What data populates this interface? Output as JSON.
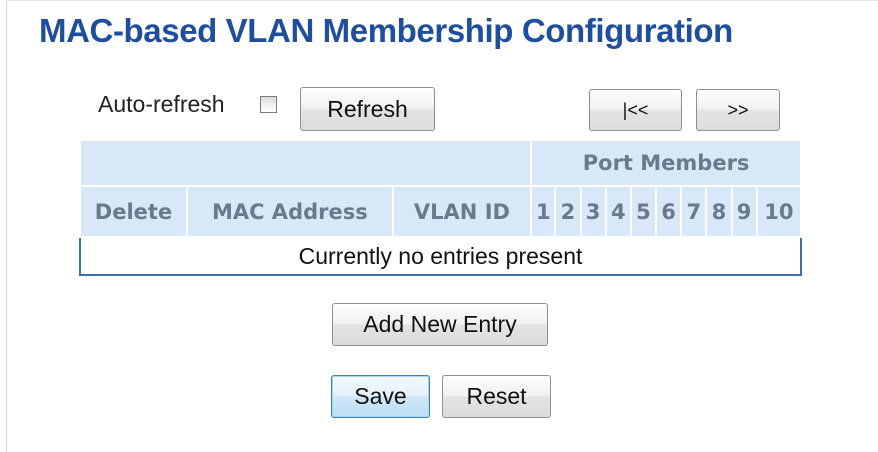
{
  "page": {
    "title": "MAC-based VLAN Membership Configuration"
  },
  "toolbar": {
    "auto_refresh_label": "Auto-refresh",
    "auto_refresh_checked": false,
    "refresh_label": "Refresh",
    "first_page_label": "|<<",
    "next_page_label": ">>"
  },
  "table": {
    "group_header": "Port Members",
    "columns": [
      "Delete",
      "MAC Address",
      "VLAN ID"
    ],
    "ports": [
      "1",
      "2",
      "3",
      "4",
      "5",
      "6",
      "7",
      "8",
      "9",
      "10"
    ],
    "empty_message": "Currently no entries present"
  },
  "actions": {
    "add_new_entry_label": "Add New Entry",
    "save_label": "Save",
    "reset_label": "Reset"
  },
  "colors": {
    "title": "#1f4f9c",
    "header_bg": "#d9e8f8",
    "header_text": "#6a7a8c",
    "table_border": "#3e6fa8"
  }
}
